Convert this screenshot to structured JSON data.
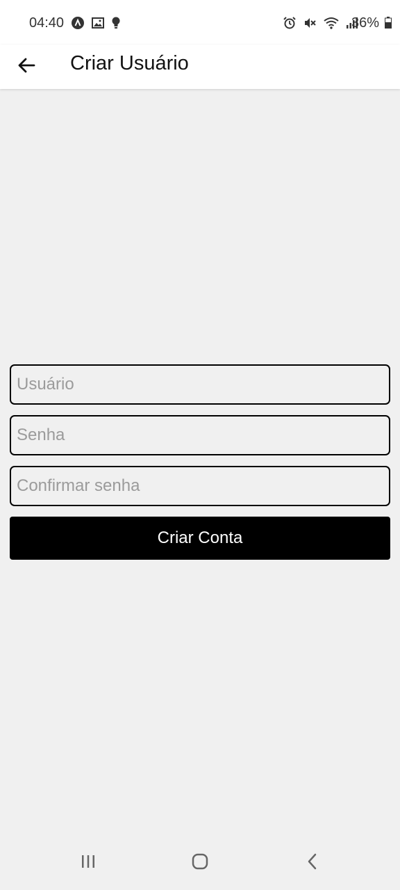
{
  "status_bar": {
    "time": "04:40",
    "battery": "36%",
    "left_icons": [
      "a-icon",
      "image-icon",
      "bulb-icon"
    ],
    "right_icons": [
      "alarm-icon",
      "mute-icon",
      "wifi-icon",
      "signal-icon",
      "battery-icon"
    ]
  },
  "app_bar": {
    "title": "Criar Usuário",
    "back_icon": "arrow-left-icon"
  },
  "form": {
    "username_placeholder": "Usuário",
    "password_placeholder": "Senha",
    "confirm_placeholder": "Confirmar senha",
    "username_value": "",
    "password_value": "",
    "confirm_value": "",
    "submit_label": "Criar Conta"
  },
  "nav_bar": {
    "buttons": [
      "recents-icon",
      "home-icon",
      "back-icon"
    ]
  },
  "colors": {
    "background": "#f0f0f0",
    "button": "#000000",
    "button_text": "#ffffff",
    "placeholder": "#9b9b9b"
  }
}
